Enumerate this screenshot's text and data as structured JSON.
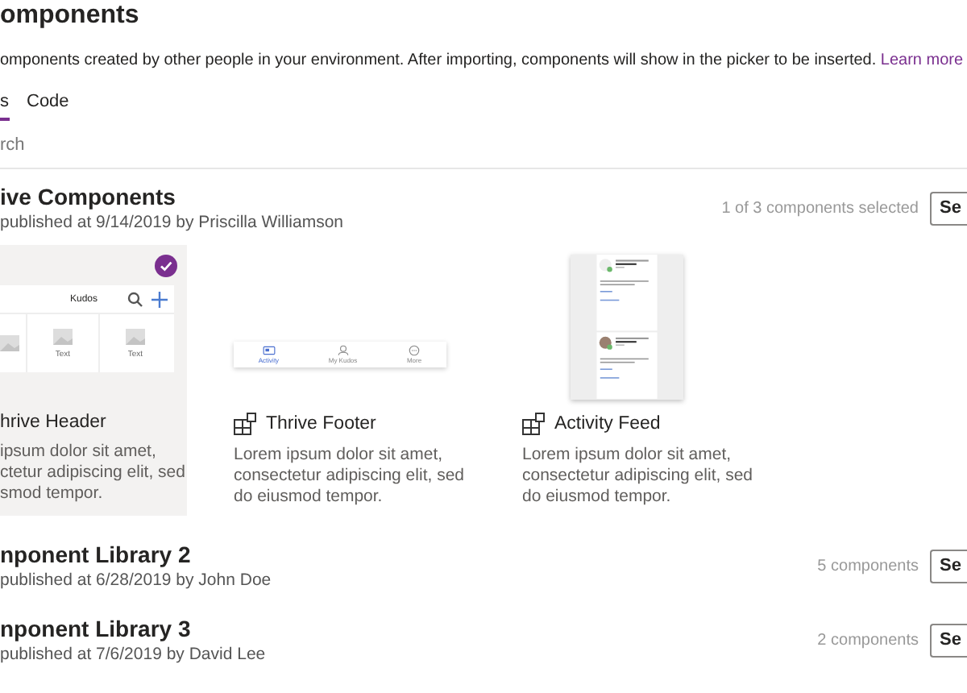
{
  "header": {
    "title": "omponents",
    "description": "omponents created by other people in your environment. After importing, components will show in the picker to be inserted.",
    "link": "Learn more"
  },
  "tabs": [
    {
      "label": "s",
      "selected": true
    },
    {
      "label": "Code",
      "selected": false
    }
  ],
  "search": {
    "placeholder": "rch"
  },
  "libraries": [
    {
      "title": "ive Components",
      "subtitle": "published at 9/14/2019 by Priscilla Williamson",
      "count": "1 of 3 components selected",
      "button": "Se",
      "components": [
        {
          "kind": "header",
          "selected": true,
          "title": "hrive Header",
          "lines": [
            "ipsum dolor sit amet,",
            "ctetur adipiscing elit, sed",
            "smod tempor."
          ],
          "preview": {
            "title": "Kudos",
            "tiles": [
              "Text",
              "Text"
            ]
          }
        },
        {
          "kind": "footer",
          "selected": false,
          "icon": true,
          "title": "Thrive Footer",
          "lines": [
            "Lorem ipsum dolor sit amet,",
            "consectetur adipiscing elit, sed",
            "do eiusmod tempor."
          ],
          "preview": {
            "tabs": [
              {
                "label": "Activity",
                "selected": true
              },
              {
                "label": "My Kudos",
                "selected": false
              },
              {
                "label": "More",
                "selected": false
              }
            ]
          }
        },
        {
          "kind": "feed",
          "selected": false,
          "icon": true,
          "title": "Activity Feed",
          "lines": [
            "Lorem ipsum dolor sit amet,",
            "consectetur adipiscing elit, sed",
            "do eiusmod tempor."
          ]
        }
      ]
    },
    {
      "title": "nponent Library 2",
      "subtitle": "published at 6/28/2019 by John Doe",
      "count": "5 components",
      "button": "Se"
    },
    {
      "title": "nponent Library 3",
      "subtitle": "published at 7/6/2019 by David Lee",
      "count": "2 components",
      "button": "Se"
    }
  ]
}
